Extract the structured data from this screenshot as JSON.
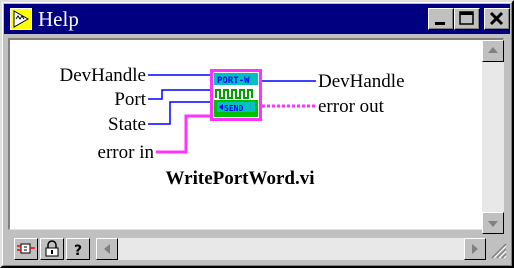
{
  "window": {
    "title": "Help",
    "icon": "labview-arrow-icon",
    "controls": [
      "minimize",
      "maximize",
      "close"
    ]
  },
  "diagram": {
    "inputs": {
      "dev_handle": "DevHandle",
      "port": "Port",
      "state": "State",
      "error_in": "error in"
    },
    "outputs": {
      "dev_handle": "DevHandle",
      "error_out": "error out"
    },
    "icon": {
      "top_text": "PORT-W",
      "bottom_text": "SEND"
    },
    "vi_name": "WritePortWord.vi"
  },
  "colors": {
    "title_bar": "#000080",
    "wire_blue": "#0000ff",
    "wire_error": "#ff33ff",
    "icon_green": "#00c000",
    "icon_cyan": "#00c0c0"
  },
  "bottom_tools": [
    "diagram-icon",
    "lock-icon",
    "question-icon"
  ]
}
